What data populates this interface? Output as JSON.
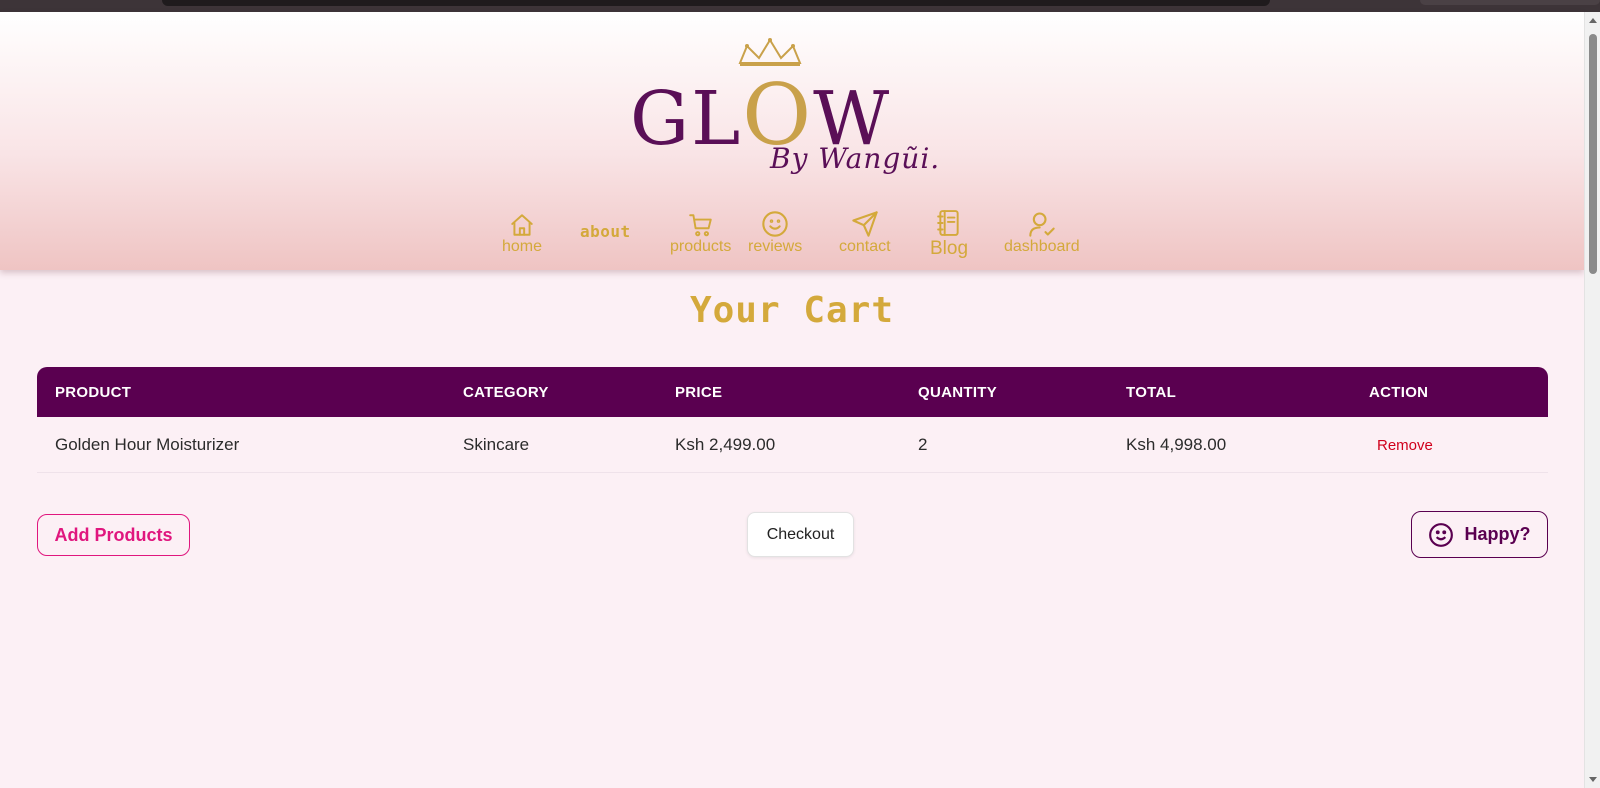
{
  "brand": {
    "logo_word": "GLOW",
    "logo_byline": "By Wangũi."
  },
  "nav": {
    "items": [
      {
        "label": "home",
        "icon": "home-icon"
      },
      {
        "label": "about"
      },
      {
        "label": "products",
        "icon": "cart-icon"
      },
      {
        "label": "reviews",
        "icon": "smiley-icon"
      },
      {
        "label": "contact",
        "icon": "send-icon"
      },
      {
        "label": "Blog",
        "icon": "notebook-icon"
      },
      {
        "label": "dashboard",
        "icon": "user-check-icon"
      }
    ]
  },
  "page": {
    "title": "Your Cart"
  },
  "cart": {
    "columns": [
      "PRODUCT",
      "CATEGORY",
      "PRICE",
      "QUANTITY",
      "TOTAL",
      "ACTION"
    ],
    "rows": [
      {
        "product": "Golden Hour Moisturizer",
        "category": "Skincare",
        "price": "Ksh 2,499.00",
        "quantity": "2",
        "total": "Ksh 4,998.00",
        "action": "Remove"
      }
    ]
  },
  "actions": {
    "add_products": "Add Products",
    "checkout": "Checkout",
    "happy": "Happy?"
  },
  "colors": {
    "brand_purple": "#5a0050",
    "gold": "#d4a93b",
    "pink_accent": "#e0167e",
    "remove_red": "#d0001c",
    "page_bg": "#fcf0f5"
  }
}
